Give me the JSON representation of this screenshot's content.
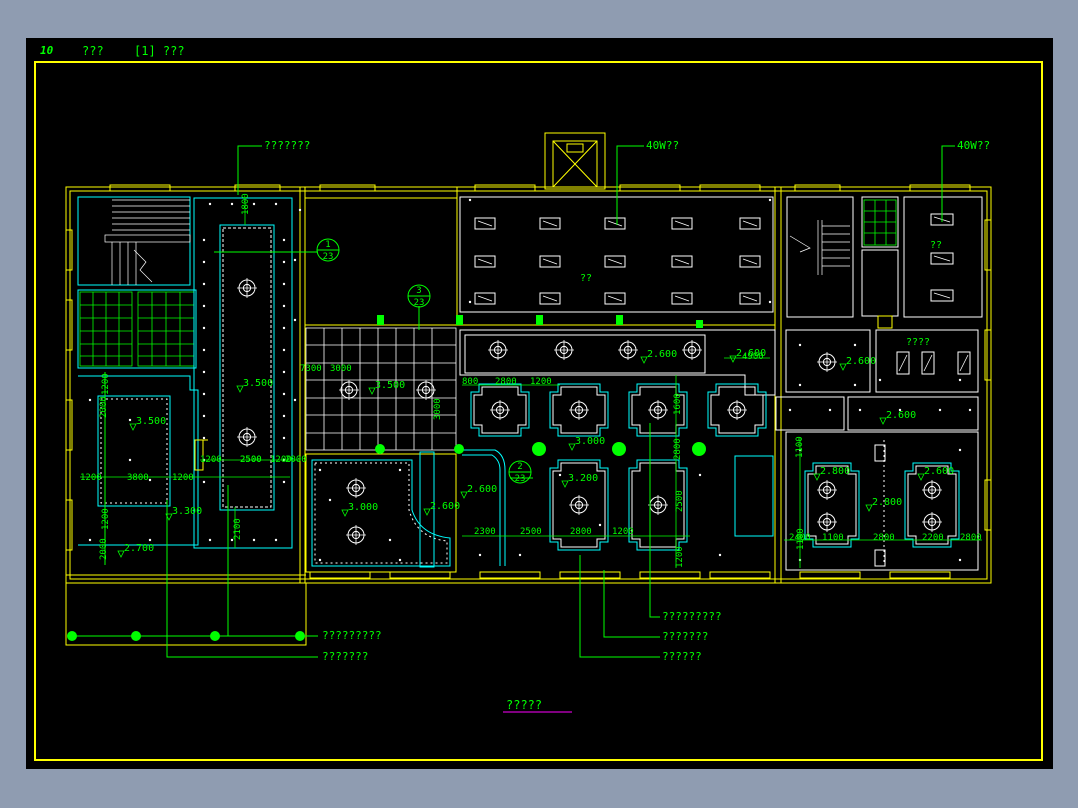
{
  "header": {
    "sheet_number": "10",
    "title": "???",
    "subtitle": "[1] ???"
  },
  "drawing_title": "?????",
  "colors": {
    "background": "#000000",
    "frame": "#ffff00",
    "annotation": "#00ff00",
    "wall": "#ffff00",
    "detail": "#00ffff",
    "fixture": "#ffffff",
    "title_underline": "#ff00ff",
    "page": "#8f9cb1"
  },
  "callouts": {
    "top_left_label": "???????",
    "top_middle_label": "40W??",
    "top_right_label": "40W??",
    "right_panel_label": "??",
    "room_small_label": "????",
    "center_label": "??",
    "bottom_1": "?????????",
    "bottom_2": "???????",
    "bottom_3": "?????????",
    "bottom_4": "???????",
    "bottom_5": "??????"
  },
  "section_marks": [
    {
      "num": "1",
      "sheet": "23"
    },
    {
      "num": "3",
      "sheet": "23"
    },
    {
      "num": "2",
      "sheet": "23"
    }
  ],
  "elevations": [
    "3.500",
    "3.500",
    "3.500",
    "3.300",
    "2.700",
    "3.000",
    "2.600",
    "2.600",
    "2.600",
    "3.000",
    "3.200",
    "2.600",
    "2.600",
    "2.800",
    "2.800",
    "2.600",
    "2.600"
  ],
  "dimensions": [
    "1800",
    "2500",
    "1200",
    "1200",
    "3800",
    "1200",
    "1200",
    "2000",
    "2000",
    "2100",
    "1200",
    "1200",
    "2500",
    "2000",
    "7300",
    "3000",
    "3000",
    "800",
    "2800",
    "1200",
    "2300",
    "2500",
    "2800",
    "1200",
    "2800",
    "1600",
    "2500",
    "4900",
    "2400",
    "1100",
    "2800",
    "2200",
    "2800",
    "1100",
    "1100",
    "1200"
  ]
}
